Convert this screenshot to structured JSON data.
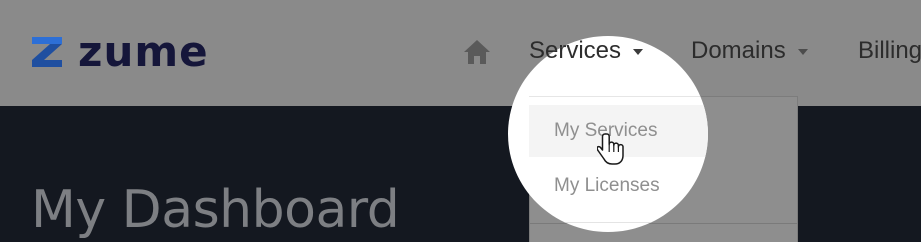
{
  "brand": {
    "name": "zume",
    "text_color": "#15163a",
    "mark_color": "#2d6fd6"
  },
  "nav": {
    "home_icon": "home-icon",
    "items": [
      {
        "label": "Services",
        "has_caret": true
      },
      {
        "label": "Domains",
        "has_caret": true
      },
      {
        "label": "Billing",
        "has_caret": false
      }
    ]
  },
  "dropdown": {
    "items": [
      {
        "label": "My Services",
        "state": "hover"
      },
      {
        "label": "My Licenses",
        "state": "default"
      }
    ]
  },
  "hero": {
    "title": "My Dashboard",
    "background": "#141820"
  },
  "overlay": {
    "dim_color": "#8c8c8c",
    "spotlight_color": "#ffffff"
  },
  "cursor": {
    "icon": "hand-pointer-icon"
  }
}
